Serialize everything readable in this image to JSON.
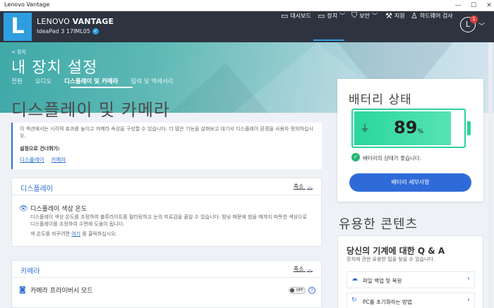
{
  "window": {
    "title": "Lenovo Vantage",
    "minimize": "—",
    "maximize": "☐",
    "close": "✕"
  },
  "header": {
    "logo_letter": "L",
    "brand_prefix": "LENOVO",
    "brand_name": "VANTAGE",
    "device_name": "IdeaPad 3 17IML05",
    "nav": [
      {
        "label": "대시보드",
        "icon": "dashboard-icon",
        "glyph": "▭"
      },
      {
        "label": "장치",
        "icon": "laptop-icon",
        "glyph": "💻",
        "active": true
      },
      {
        "label": "보안",
        "icon": "shield-icon",
        "glyph": "⛉"
      },
      {
        "label": "지원",
        "icon": "wrench-icon",
        "glyph": "🔧"
      },
      {
        "label": "하드웨어 검사",
        "icon": "person-icon",
        "glyph": "⚲"
      }
    ],
    "avatar_letter": "L",
    "notification_count": "1"
  },
  "hero": {
    "back_label": "< 장치",
    "title": "내 장치 설정",
    "tabs": [
      "전원",
      "오디오",
      "디스플레이 및 카메라",
      "입력 및 액세서리"
    ],
    "active_tab": 2
  },
  "main": {
    "title": "디스플레이 및 카메라",
    "intro": "이 섹션에서는 시각적 효과를 높이고 카메라 속성을 구성할 수 있습니다. 더 많은 기능을 살펴보고 대기서 디스플레이 환경을 사용자 정의하십시오.",
    "shortcut_label": "설정으로 건너뛰기:",
    "shortcuts": [
      "디스플레이",
      "카메라"
    ],
    "display_card": {
      "title": "디스플레이",
      "collapse_label": "축소",
      "color_temp_title": "디스플레이 색상 온도",
      "color_temp_desc": "디스플레이 색상 온도를 조정하여 블루라이트를 필터링하고 눈의 피로감을 줄일 수 있습니다. 밤낮 때문에 밤을 때까지 따뜻한 색상으로 디스플레이를 조정하여 수면에 도움이 됩니다.",
      "color_temp_hint_prefix": "색 온도를 바꾸려면",
      "color_temp_hint_link": "여기",
      "color_temp_hint_suffix": "를 클릭하십시오."
    },
    "camera_card": {
      "title": "카메라",
      "collapse_label": "축소",
      "privacy_title": "카메라 프라이버시 모드",
      "toggle_label": "OFF"
    }
  },
  "battery": {
    "title": "배터리 상태",
    "percent": 89,
    "percent_unit": "%",
    "status": "배터리의 상태가 좋습니다.",
    "details_button": "배터리 세부사항"
  },
  "useful": {
    "title": "유용한 콘텐츠",
    "qa_title": "당신의 기계에 대한 Q & A",
    "qa_sub": "장치에 관한 유용한 팁을 찾을 수 있습니다.",
    "items": [
      "파일 백업 및 복원",
      "PC를 초기화하는 방법"
    ]
  }
}
